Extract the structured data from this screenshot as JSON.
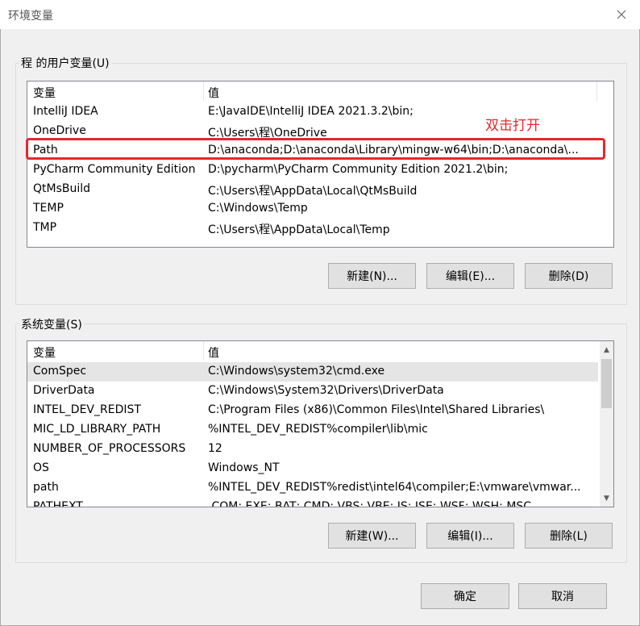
{
  "window": {
    "title": "环境变量",
    "close_icon": "close-icon"
  },
  "user_vars": {
    "group_label": "程 的用户变量(U)",
    "headers": {
      "name": "变量",
      "value": "值"
    },
    "rows": [
      {
        "name": "IntelliJ IDEA",
        "value": "E:\\JavaIDE\\IntelliJ IDEA 2021.3.2\\bin;"
      },
      {
        "name": "OneDrive",
        "value": "C:\\Users\\程\\OneDrive"
      },
      {
        "name": "Path",
        "value": "D:\\anaconda;D:\\anaconda\\Library\\mingw-w64\\bin;D:\\anaconda\\..."
      },
      {
        "name": "PyCharm Community Edition",
        "value": "D:\\pycharm\\PyCharm Community Edition 2021.2\\bin;"
      },
      {
        "name": "QtMsBuild",
        "value": "C:\\Users\\程\\AppData\\Local\\QtMsBuild"
      },
      {
        "name": "TEMP",
        "value": "C:\\Windows\\Temp"
      },
      {
        "name": "TMP",
        "value": "C:\\Users\\程\\AppData\\Local\\Temp"
      }
    ],
    "buttons": {
      "new": "新建(N)...",
      "edit": "编辑(E)...",
      "delete": "删除(D)"
    }
  },
  "annotation": {
    "text": "双击打开",
    "color": "#e8262b"
  },
  "system_vars": {
    "group_label": "系统变量(S)",
    "headers": {
      "name": "变量",
      "value": "值"
    },
    "rows": [
      {
        "name": "ComSpec",
        "value": "C:\\Windows\\system32\\cmd.exe"
      },
      {
        "name": "DriverData",
        "value": "C:\\Windows\\System32\\Drivers\\DriverData"
      },
      {
        "name": "INTEL_DEV_REDIST",
        "value": "C:\\Program Files (x86)\\Common Files\\Intel\\Shared Libraries\\"
      },
      {
        "name": "MIC_LD_LIBRARY_PATH",
        "value": "%INTEL_DEV_REDIST%compiler\\lib\\mic"
      },
      {
        "name": "NUMBER_OF_PROCESSORS",
        "value": "12"
      },
      {
        "name": "OS",
        "value": "Windows_NT"
      },
      {
        "name": "path",
        "value": "%INTEL_DEV_REDIST%redist\\intel64\\compiler;E:\\vmware\\vmwar..."
      },
      {
        "name": "PATHEXT",
        "value": ".COM;.EXE;.BAT;.CMD;.VBS;.VBE;.JS;.JSE;.WSF;.WSH;.MSC"
      }
    ],
    "buttons": {
      "new": "新建(W)...",
      "edit": "编辑(I)...",
      "delete": "删除(L)"
    }
  },
  "footer": {
    "ok": "确定",
    "cancel": "取消"
  }
}
